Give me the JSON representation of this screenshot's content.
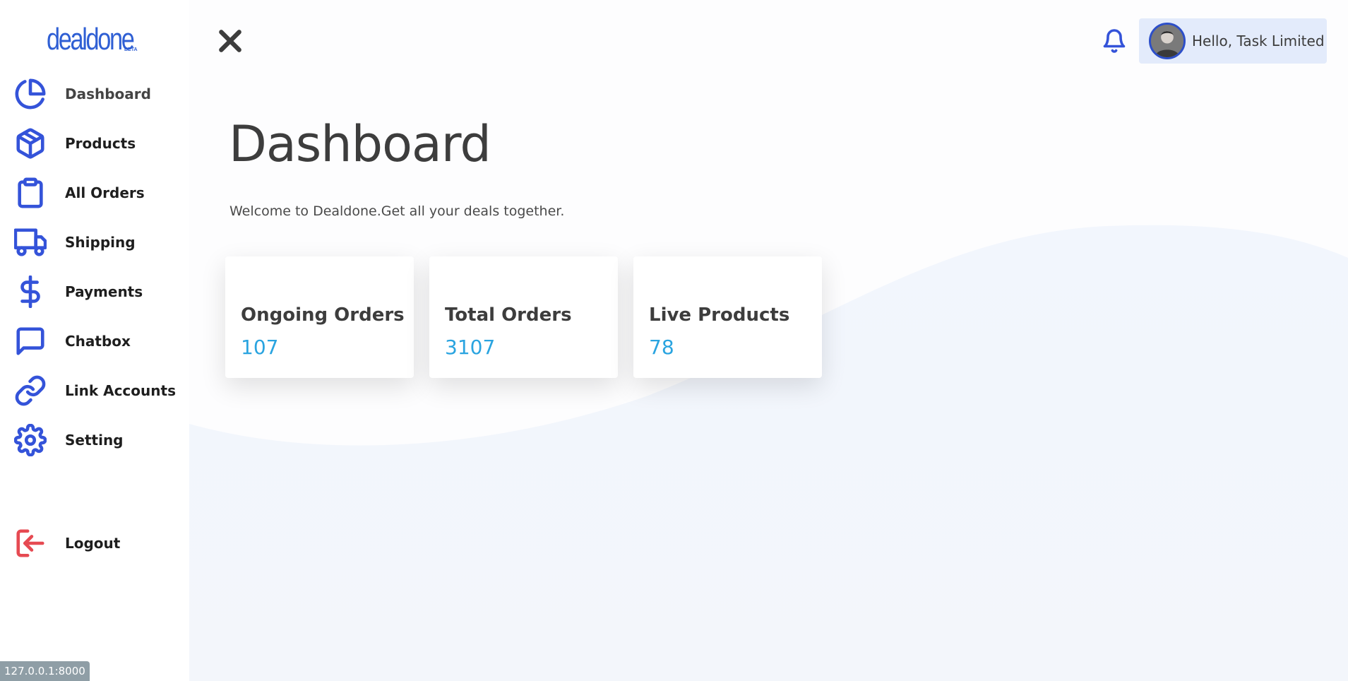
{
  "brand": {
    "logo_text": "dealdone",
    "logo_badge": "BETA",
    "accent_color": "#3453d9",
    "value_color": "#2aa4e0",
    "logout_color": "#e64a52"
  },
  "sidebar": {
    "items": [
      {
        "label": "Dashboard",
        "icon": "pie-chart-icon"
      },
      {
        "label": "Products",
        "icon": "box-icon"
      },
      {
        "label": "All Orders",
        "icon": "clipboard-icon"
      },
      {
        "label": "Shipping",
        "icon": "truck-icon"
      },
      {
        "label": "Payments",
        "icon": "dollar-icon"
      },
      {
        "label": "Chatbox",
        "icon": "chat-icon"
      },
      {
        "label": "Link Accounts",
        "icon": "link-icon"
      },
      {
        "label": "Setting",
        "icon": "gear-icon"
      }
    ],
    "logout_label": "Logout"
  },
  "header": {
    "user_greeting": "Hello, Task Limited"
  },
  "main": {
    "title": "Dashboard",
    "welcome": "Welcome to Dealdone.Get all your deals together.",
    "cards": [
      {
        "title": "Ongoing Orders",
        "value": "107"
      },
      {
        "title": "Total Orders",
        "value": "3107"
      },
      {
        "title": "Live Products",
        "value": "78"
      }
    ]
  },
  "status_url": "127.0.0.1:8000"
}
